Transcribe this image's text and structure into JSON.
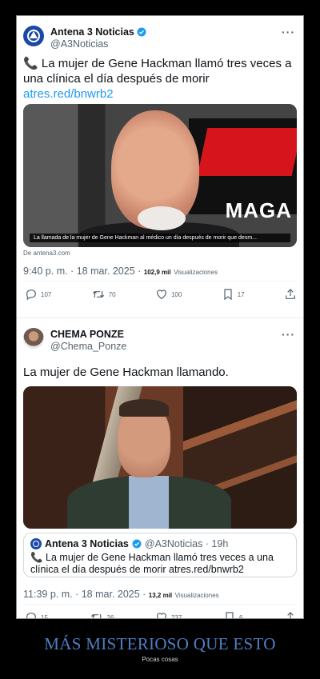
{
  "tweets": [
    {
      "display_name": "Antena 3 Noticias",
      "handle": "@A3Noticias",
      "more": "···",
      "text_emoji": "📞",
      "text": "La mujer de Gene Hackman llamó tres veces a una clínica el día después de morir",
      "link": "atres.red/bnwrb2",
      "media_caption": "La llamada de la mujer de Gene Hackman al médico un día después de morir que desm...",
      "source": "De antena3.com",
      "time": "9:40 p. m. · 18 mar. 2025 · ",
      "views": "102,9 mil",
      "views_label": "Visualizaciones",
      "replies": "107",
      "retweets": "70",
      "likes": "100",
      "bookmarks": "17"
    },
    {
      "display_name": "CHEMA PONZE",
      "handle": "@Chema_Ponze",
      "more": "···",
      "text": "La mujer de Gene Hackman llamando.",
      "quote": {
        "display_name": "Antena 3 Noticias",
        "handle_time": "@A3Noticias · 19h",
        "text": "📞 La mujer de Gene Hackman llamó tres veces a una clínica el día después de morir atres.red/bnwrb2"
      },
      "time": "11:39 p. m. · 18 mar. 2025 · ",
      "views": "13,2 mil",
      "views_label": "Visualizaciones",
      "replies": "15",
      "retweets": "26",
      "likes": "237",
      "bookmarks": "6"
    }
  ],
  "poster": {
    "title": "MÁS MISTERIOSO QUE ESTO",
    "subtitle": "Pocas cosas"
  },
  "colors": {
    "link": "#1d9bf0",
    "verified": "#1d9bf0",
    "title": "#4e7fc6",
    "background": "#000000"
  }
}
